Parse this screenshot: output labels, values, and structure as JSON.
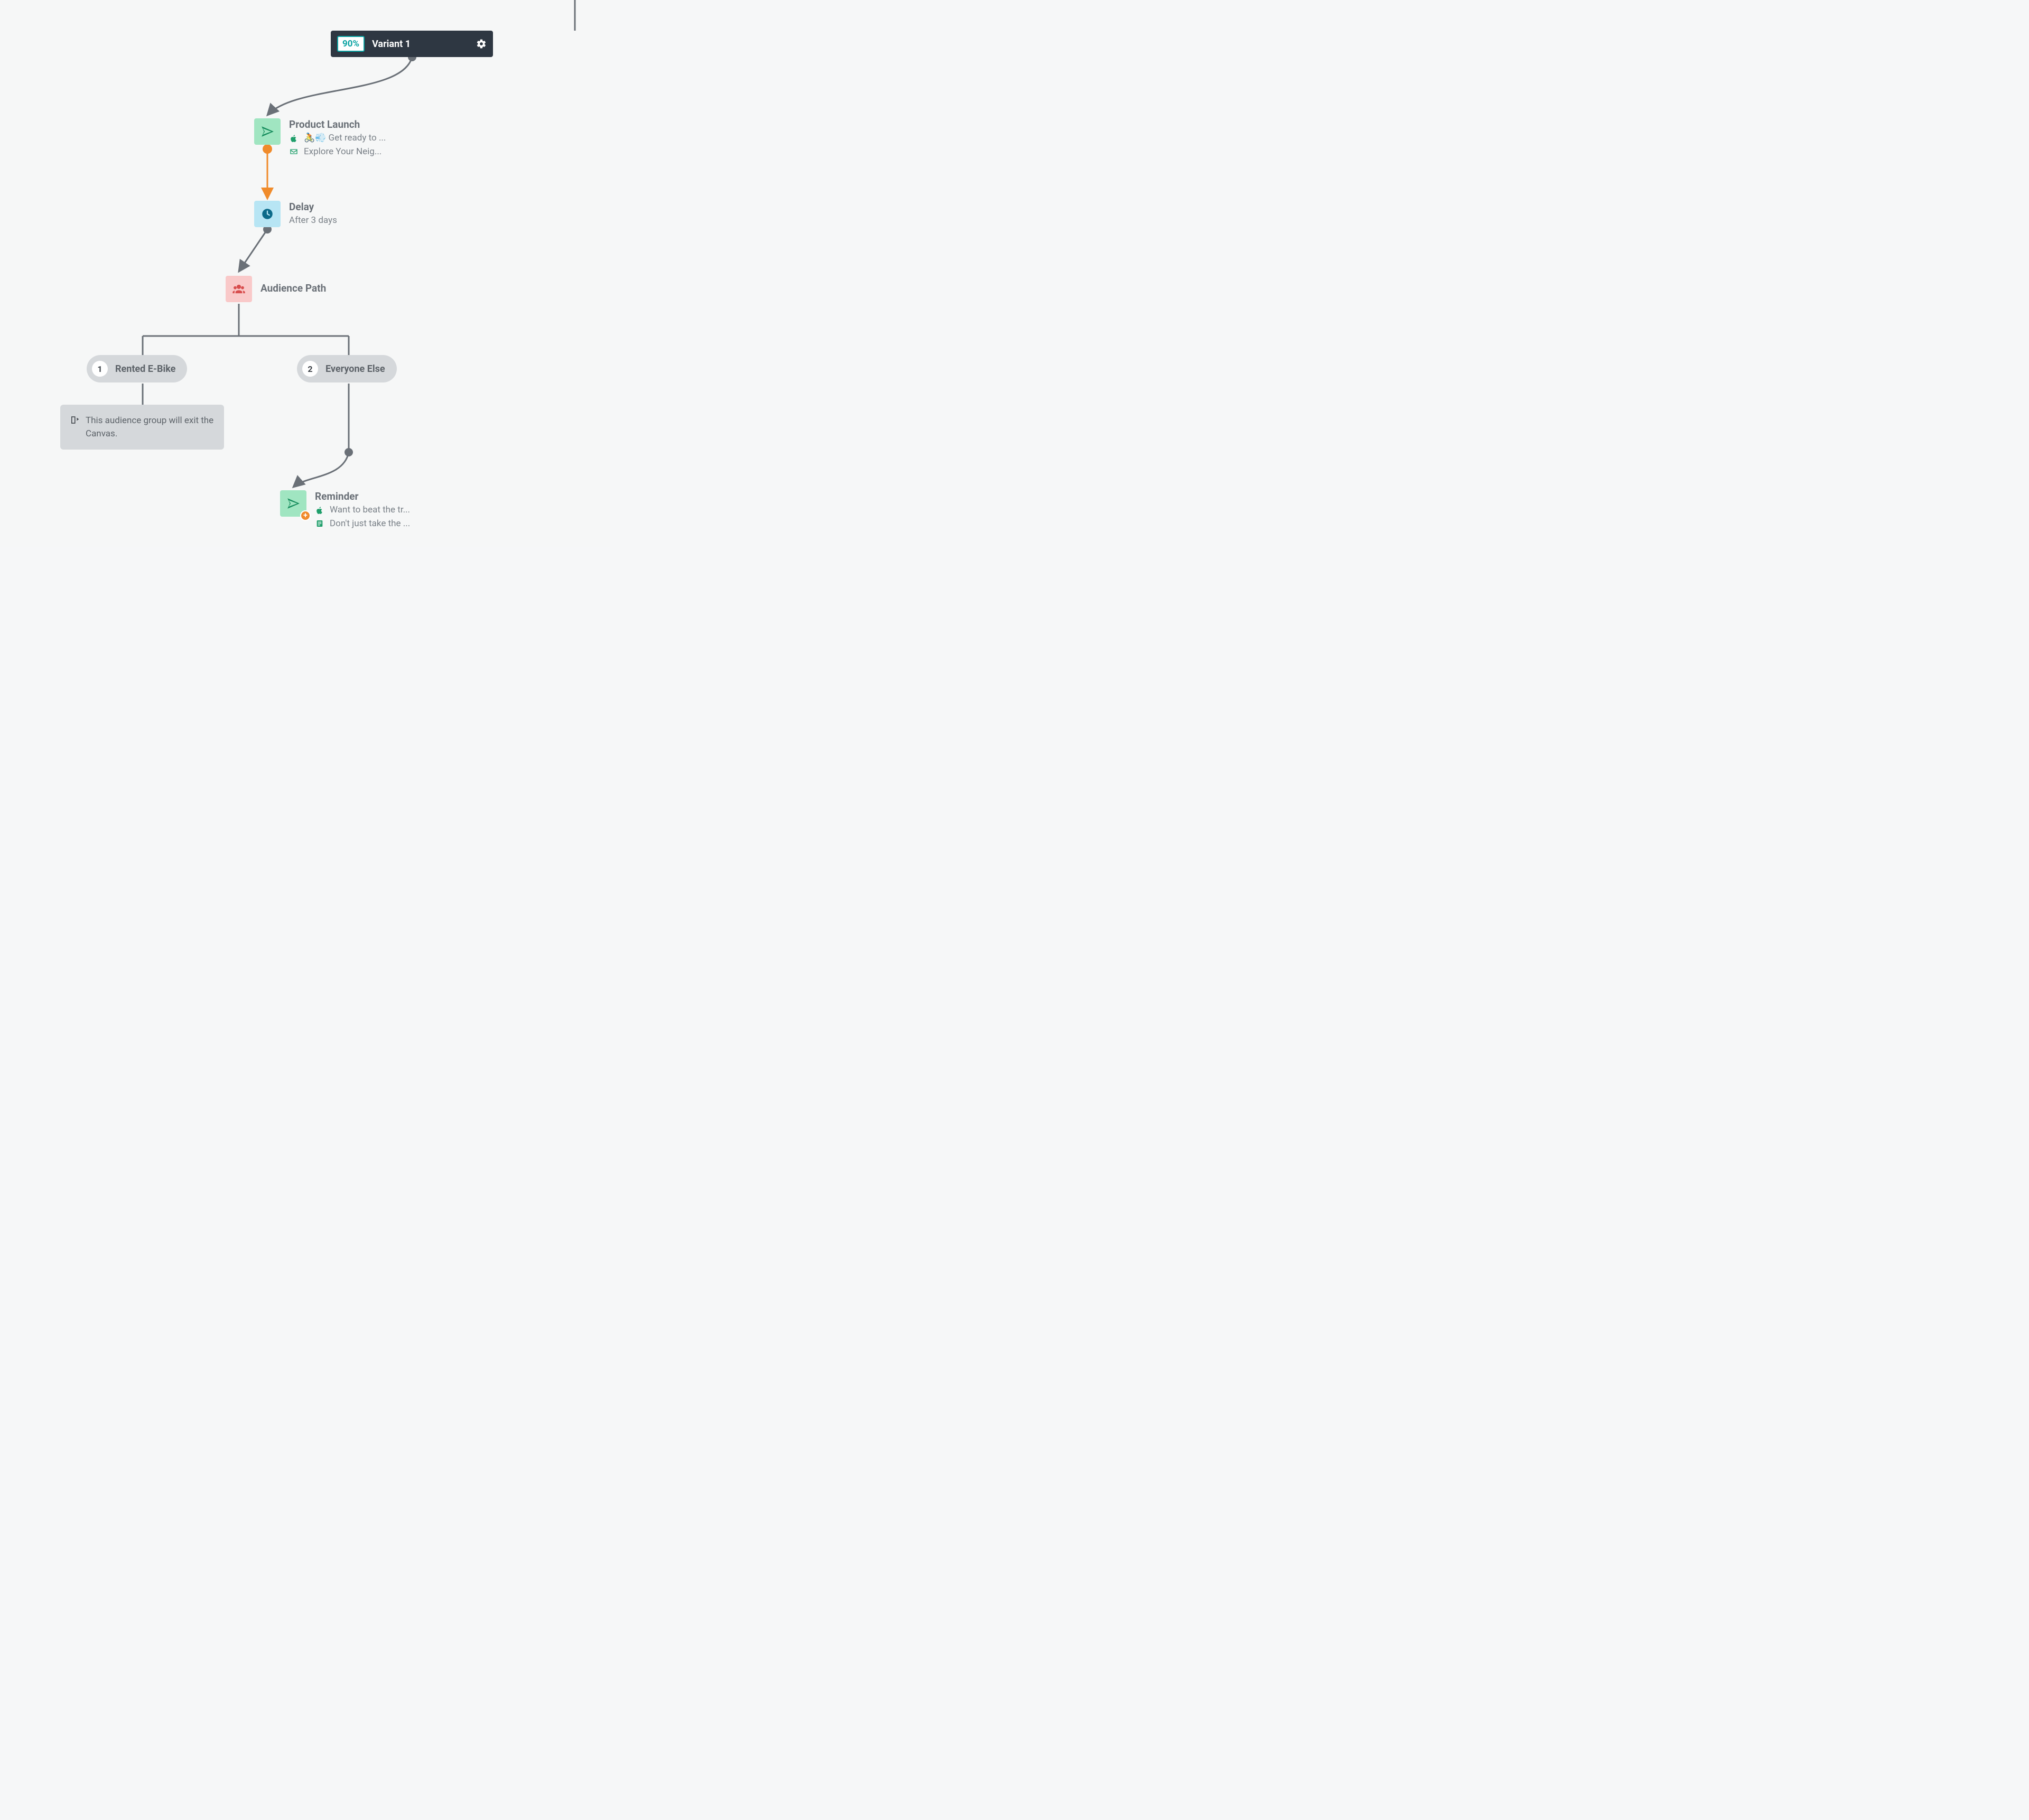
{
  "variant": {
    "percent": "90%",
    "label": "Variant 1"
  },
  "steps": {
    "productLaunch": {
      "title": "Product Launch",
      "line1": "🚴💨 Get ready to ...",
      "line2": "Explore Your Neig..."
    },
    "delay": {
      "title": "Delay",
      "detail": "After 3 days"
    },
    "audiencePath": {
      "title": "Audience Path"
    },
    "reminder": {
      "title": "Reminder",
      "line1": "Want to beat the tr...",
      "line2": "Don't just take the ..."
    }
  },
  "paths": {
    "p1": {
      "num": "1",
      "label": "Rented E-Bike"
    },
    "p2": {
      "num": "2",
      "label": "Everyone Else"
    }
  },
  "exit": {
    "text": "This audience group will exit the Canvas."
  },
  "colors": {
    "variantBg": "#2e3742",
    "accentTeal": "#0aa3a3",
    "edge": "#6a7077",
    "edgeActive": "#f08b2b",
    "tileGreen": "#a0e5c1",
    "tileBlue": "#b7e5f4",
    "tilePink": "#f9c9c9"
  }
}
